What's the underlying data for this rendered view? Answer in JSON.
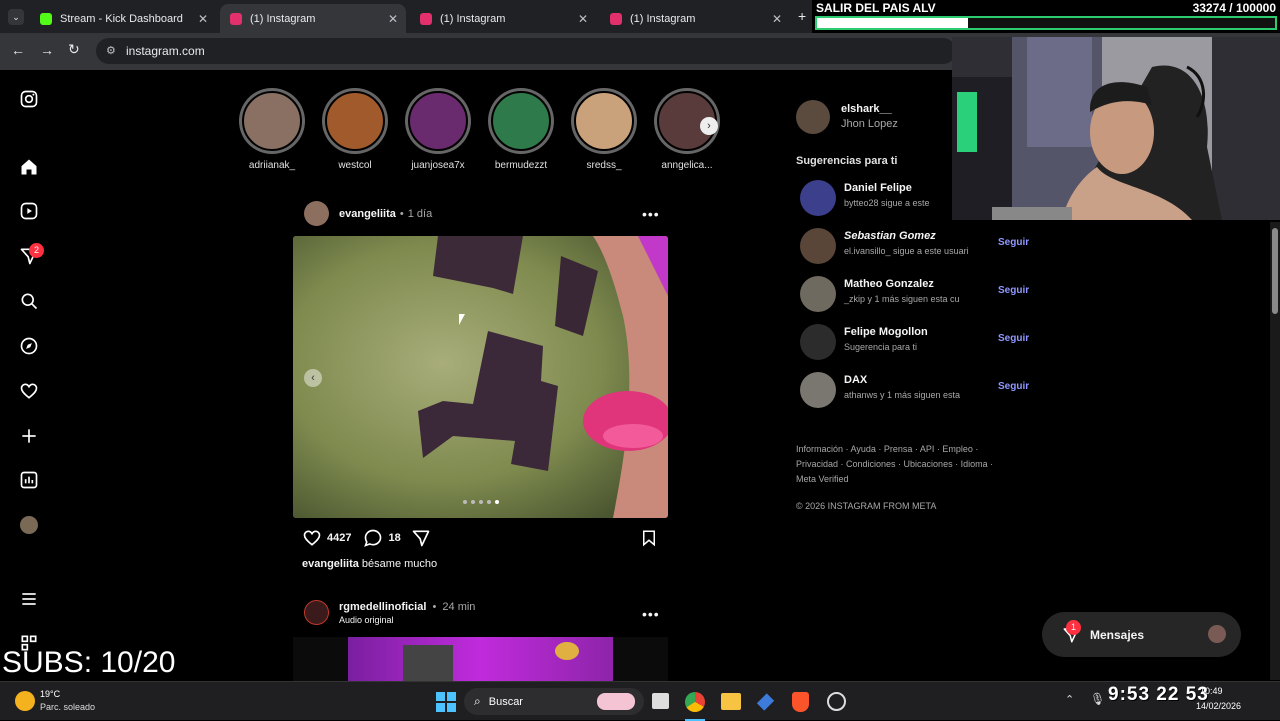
{
  "browser": {
    "tabs": [
      {
        "label": "Stream - Kick Dashboard",
        "icon": "kick-icon",
        "color": "#53fc18"
      },
      {
        "label": "(1) Instagram",
        "icon": "instagram-icon",
        "color": "#e1306c"
      },
      {
        "label": "(1) Instagram",
        "icon": "instagram-icon",
        "color": "#e1306c"
      },
      {
        "label": "(1) Instagram",
        "icon": "instagram-icon",
        "color": "#e1306c"
      }
    ],
    "url": "instagram.com"
  },
  "overlay": {
    "goal_title": "SALIR DEL PAIS ALV",
    "goal_count": "33274 / 100000",
    "goal_progress": 0.33,
    "subs": "SUBS: 10/20"
  },
  "stories": [
    {
      "name": "adriianak_"
    },
    {
      "name": "westcol"
    },
    {
      "name": "juanjosea7x"
    },
    {
      "name": "bermudezzt"
    },
    {
      "name": "sredss_"
    },
    {
      "name": "anngelica..."
    }
  ],
  "posts": [
    {
      "user": "evangeliita",
      "time": "1 día",
      "likes": "4427",
      "comments": "18",
      "caption": "bésame mucho"
    },
    {
      "user": "rgmedellinoficial",
      "time": "24 min",
      "audio": "Audio original"
    }
  ],
  "profile": {
    "username": "elshark__",
    "fullname": "Jhon Lopez"
  },
  "suggestions_title": "Sugerencias para ti",
  "suggestions": [
    {
      "name": "Daniel Felipe",
      "sub": "bytteo28 sigue a este",
      "follow": ""
    },
    {
      "name": "Sebastian Gomez",
      "sub": "el.ivansillo_ sigue a este usuari",
      "follow": "Seguir"
    },
    {
      "name": "Matheo Gonzalez",
      "sub": "_zkip y 1 más siguen esta cu",
      "follow": "Seguir"
    },
    {
      "name": "Felipe Mogollon",
      "sub": "Sugerencia para ti",
      "follow": "Seguir"
    },
    {
      "name": "DAX",
      "sub": "athanws y 1 más siguen esta",
      "follow": "Seguir"
    }
  ],
  "footer": {
    "line1": "Información · Ayuda · Prensa · API · Empleo ·",
    "line2": "Privacidad · Condiciones · Ubicaciones · Idioma ·",
    "line3": "Meta Verified",
    "copyright": "© 2026 INSTAGRAM FROM META"
  },
  "messages": {
    "label": "Mensajes",
    "badge": "1"
  },
  "sidebar_badge": "2",
  "taskbar": {
    "weather_temp": "19°C",
    "weather_desc": "Parc. soleado",
    "search": "Buscar",
    "timer": "9:53 22 53",
    "clock_time": "10:49",
    "clock_date": "14/02/2026"
  }
}
